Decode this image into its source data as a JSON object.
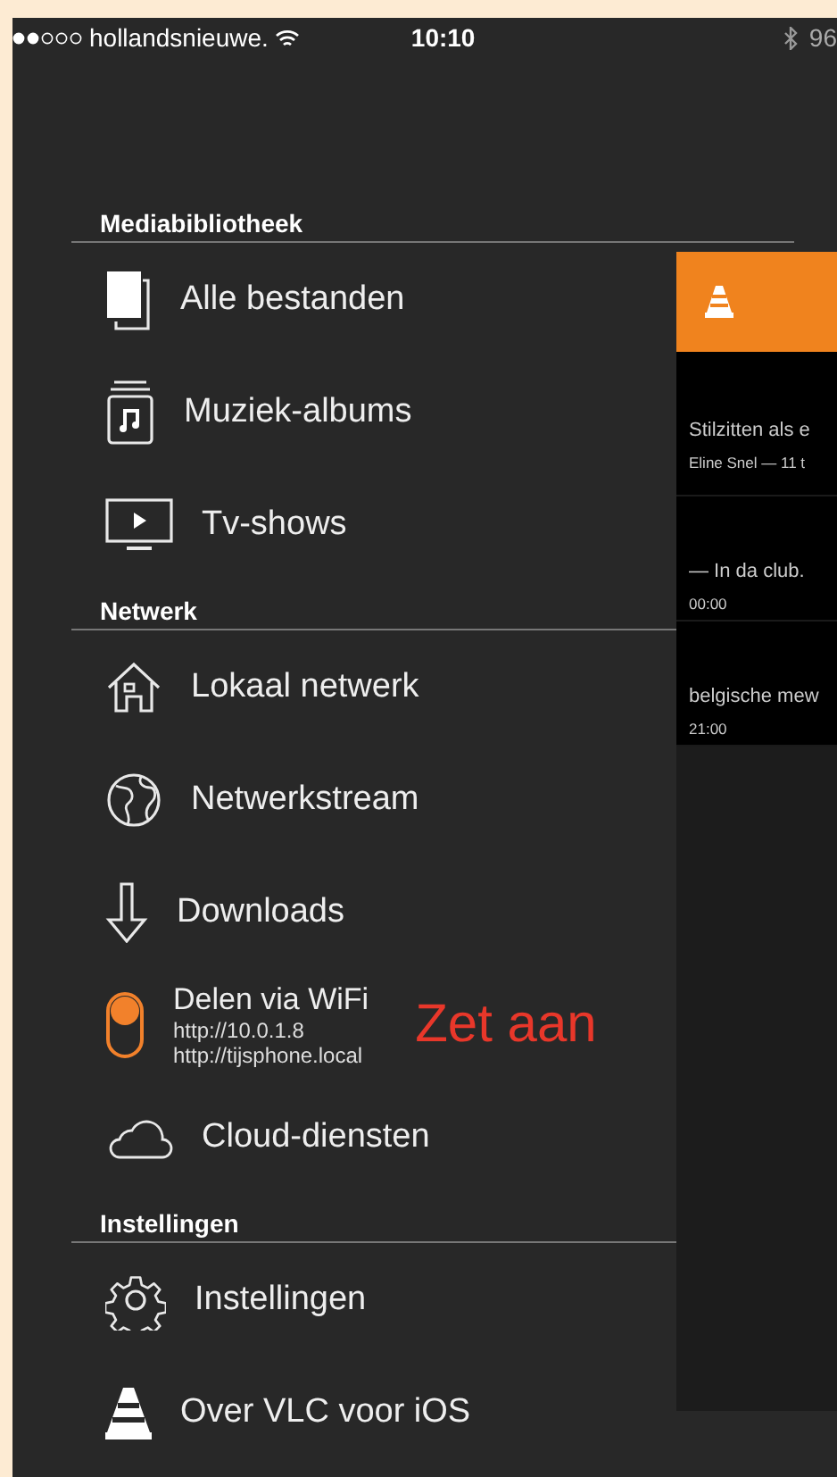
{
  "status_bar": {
    "carrier": "hollandsnieuwe.",
    "time": "10:10",
    "battery": "96"
  },
  "sections": [
    {
      "title": "Mediabibliotheek",
      "items": [
        {
          "kind": "files",
          "label": "Alle bestanden"
        },
        {
          "kind": "music",
          "label": "Muziek-albums"
        },
        {
          "kind": "tv",
          "label": "Tv-shows"
        }
      ]
    },
    {
      "title": "Netwerk",
      "items": [
        {
          "kind": "home",
          "label": "Lokaal netwerk"
        },
        {
          "kind": "globe",
          "label": "Netwerkstream"
        },
        {
          "kind": "download",
          "label": "Downloads"
        },
        {
          "kind": "toggle",
          "label": "Delen via WiFi",
          "on": true,
          "details": [
            "http://10.0.1.8",
            "http://tijsphone.local"
          ],
          "annotation": "Zet aan"
        },
        {
          "kind": "cloud",
          "label": "Cloud-diensten"
        }
      ]
    },
    {
      "title": "Instellingen",
      "items": [
        {
          "kind": "gear",
          "label": "Instellingen"
        },
        {
          "kind": "cone",
          "label": "Over VLC voor iOS"
        }
      ]
    }
  ],
  "media_list": [
    {
      "title": "Stilzitten als e",
      "subtitle": "Eline Snel — 11 t"
    },
    {
      "title": "— In da club.",
      "subtitle": "00:00"
    },
    {
      "title": "belgische mew",
      "subtitle": "21:00"
    }
  ]
}
